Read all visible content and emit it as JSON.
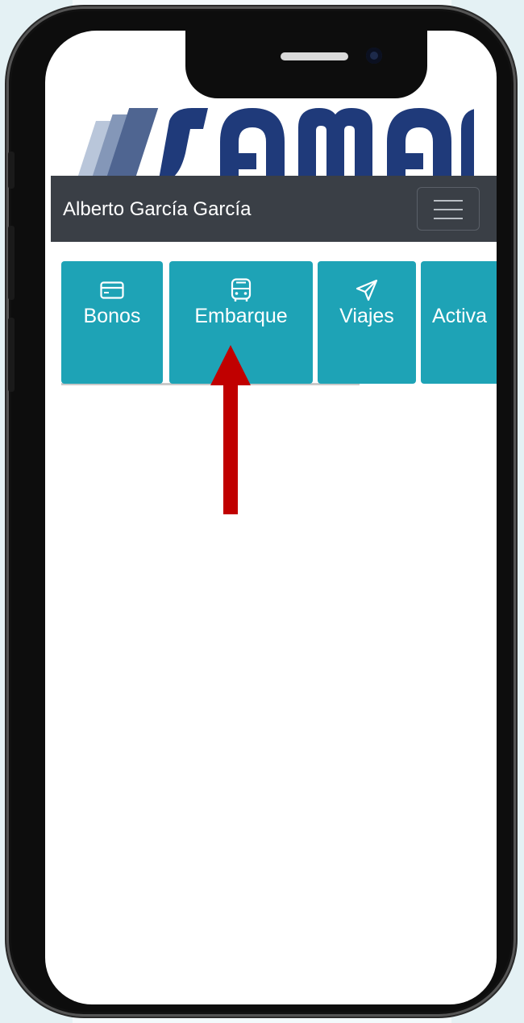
{
  "app": {
    "logo_text": "samar",
    "user_name": "Alberto García García"
  },
  "tabs": [
    {
      "label": "Bonos",
      "icon": "credit-card-icon"
    },
    {
      "label": "Embarque",
      "icon": "bus-icon"
    },
    {
      "label": "Viajes",
      "icon": "send-icon"
    },
    {
      "label": "Activa",
      "icon": "unknown-icon"
    }
  ],
  "colors": {
    "tab_bg": "#1ea3b6",
    "navbar_bg": "#3a3f46",
    "logo_blue": "#1f3a7a",
    "annotation_arrow": "#c00000"
  },
  "annotation": {
    "points_to": "Embarque"
  }
}
